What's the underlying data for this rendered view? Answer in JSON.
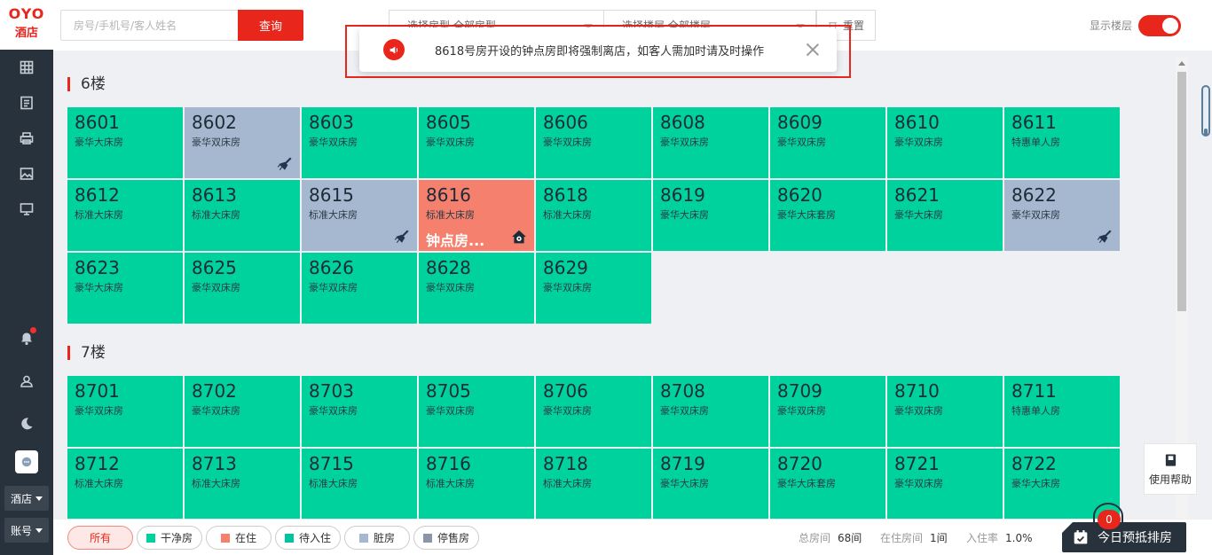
{
  "brand": {
    "logo": "OYO",
    "sub": "酒店"
  },
  "sidebar": {
    "icons": [
      "grid-icon",
      "list-icon",
      "printer-icon",
      "image-icon",
      "monitor-icon",
      "bell-icon",
      "user-icon",
      "moon-icon",
      "chat-icon"
    ],
    "menus": [
      {
        "label": "酒店"
      },
      {
        "label": "账号"
      }
    ]
  },
  "topbar": {
    "search_placeholder": "房号/手机号/客人姓名",
    "search_label": "查询",
    "room_type_select": "选择房型  全部房型",
    "floor_select": "选择楼层  全部楼层",
    "reset_label": "重置",
    "show_floor_label": "显示楼层",
    "show_floor_on": true
  },
  "notice": {
    "text": "8618号房开设的钟点房即将强制离店，如客人需加时请及时操作"
  },
  "floors": [
    {
      "title": "6楼",
      "rooms": [
        {
          "num": "8601",
          "type": "豪华大床房",
          "state": "clean"
        },
        {
          "num": "8602",
          "type": "豪华双床房",
          "state": "dirty"
        },
        {
          "num": "8603",
          "type": "豪华双床房",
          "state": "clean"
        },
        {
          "num": "8605",
          "type": "豪华双床房",
          "state": "clean"
        },
        {
          "num": "8606",
          "type": "豪华双床房",
          "state": "clean"
        },
        {
          "num": "8608",
          "type": "豪华双床房",
          "state": "clean"
        },
        {
          "num": "8609",
          "type": "豪华双床房",
          "state": "clean"
        },
        {
          "num": "8610",
          "type": "豪华双床房",
          "state": "clean"
        },
        {
          "num": "8611",
          "type": "特惠单人房",
          "state": "clean"
        },
        {
          "num": "8612",
          "type": "标准大床房",
          "state": "clean"
        },
        {
          "num": "8613",
          "type": "标准大床房",
          "state": "clean"
        },
        {
          "num": "8615",
          "type": "标准大床房",
          "state": "dirty"
        },
        {
          "num": "8616",
          "type": "标准大床房",
          "state": "occupied",
          "status": "钟点房..."
        },
        {
          "num": "8618",
          "type": "标准大床房",
          "state": "clean"
        },
        {
          "num": "8619",
          "type": "豪华大床房",
          "state": "clean"
        },
        {
          "num": "8620",
          "type": "豪华大床套房",
          "state": "clean"
        },
        {
          "num": "8621",
          "type": "豪华大床房",
          "state": "clean"
        },
        {
          "num": "8622",
          "type": "豪华双床房",
          "state": "dirty"
        },
        {
          "num": "8623",
          "type": "豪华大床房",
          "state": "clean"
        },
        {
          "num": "8625",
          "type": "豪华双床房",
          "state": "clean"
        },
        {
          "num": "8626",
          "type": "豪华双床房",
          "state": "clean"
        },
        {
          "num": "8628",
          "type": "豪华双床房",
          "state": "clean"
        },
        {
          "num": "8629",
          "type": "豪华双床房",
          "state": "clean"
        }
      ]
    },
    {
      "title": "7楼",
      "rooms": [
        {
          "num": "8701",
          "type": "豪华双床房",
          "state": "clean"
        },
        {
          "num": "8702",
          "type": "豪华双床房",
          "state": "clean"
        },
        {
          "num": "8703",
          "type": "豪华双床房",
          "state": "clean"
        },
        {
          "num": "8705",
          "type": "豪华双床房",
          "state": "clean"
        },
        {
          "num": "8706",
          "type": "豪华双床房",
          "state": "clean"
        },
        {
          "num": "8708",
          "type": "豪华双床房",
          "state": "clean"
        },
        {
          "num": "8709",
          "type": "豪华双床房",
          "state": "clean"
        },
        {
          "num": "8710",
          "type": "豪华双床房",
          "state": "clean"
        },
        {
          "num": "8711",
          "type": "特惠单人房",
          "state": "clean"
        },
        {
          "num": "8712",
          "type": "标准大床房",
          "state": "clean"
        },
        {
          "num": "8713",
          "type": "标准大床房",
          "state": "clean"
        },
        {
          "num": "8715",
          "type": "标准大床房",
          "state": "clean"
        },
        {
          "num": "8716",
          "type": "标准大床房",
          "state": "clean"
        },
        {
          "num": "8718",
          "type": "标准大床房",
          "state": "clean"
        },
        {
          "num": "8719",
          "type": "豪华大床房",
          "state": "clean"
        },
        {
          "num": "8720",
          "type": "豪华大床套房",
          "state": "clean"
        },
        {
          "num": "8721",
          "type": "豪华双床房",
          "state": "clean"
        },
        {
          "num": "8722",
          "type": "豪华大床房",
          "state": "clean"
        }
      ]
    }
  ],
  "help": {
    "label": "使用帮助"
  },
  "legend": [
    {
      "label": "所有",
      "color": "",
      "active": true
    },
    {
      "label": "干净房",
      "color": "#00d29e"
    },
    {
      "label": "在住",
      "color": "#f5806e"
    },
    {
      "label": "待入住",
      "color": "#00c4a0"
    },
    {
      "label": "脏房",
      "color": "#a5b8d0"
    },
    {
      "label": "停售房",
      "color": "#8a96a8"
    }
  ],
  "stats": {
    "total_label": "总房间",
    "total_value": "68间",
    "occupied_label": "在住房间",
    "occupied_value": "1间",
    "rate_label": "入住率",
    "rate_value": "1.0%"
  },
  "booking": {
    "label": "今日预抵排房",
    "count": "0"
  },
  "colors": {
    "accent": "#e8261c",
    "clean": "#00d29e",
    "dirty": "#a5b8d0",
    "occupied": "#f5806e",
    "sidebar": "#28323c"
  }
}
